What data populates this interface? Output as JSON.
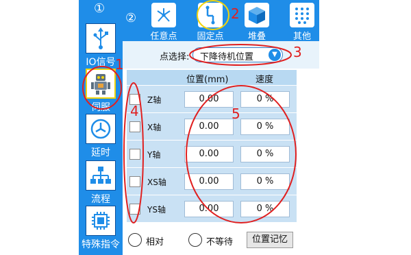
{
  "sidebar": {
    "top_badge": "①",
    "items": [
      {
        "label": "IO信号",
        "icon": "usb-icon"
      },
      {
        "label": "伺服",
        "icon": "robot-icon"
      },
      {
        "label": "延时",
        "icon": "clock-icon"
      },
      {
        "label": "流程",
        "icon": "flowchart-icon"
      },
      {
        "label": "特殊指令",
        "icon": "chip-icon"
      }
    ]
  },
  "tabs": {
    "badge": "②",
    "items": [
      {
        "label": "任意点",
        "icon": "scatter-points-icon"
      },
      {
        "label": "固定点",
        "icon": "fixed-point-icon"
      },
      {
        "label": "堆叠",
        "icon": "stack-box-icon"
      },
      {
        "label": "其他",
        "icon": "dot-grid-icon"
      }
    ]
  },
  "point_select": {
    "label": "点选择:",
    "value": "下降待机位置"
  },
  "table": {
    "headers": {
      "position": "位置(mm)",
      "speed": "速度"
    },
    "rows": [
      {
        "axis": "Z轴",
        "position": "0.00",
        "speed": "0 %"
      },
      {
        "axis": "X轴",
        "position": "0.00",
        "speed": "0 %"
      },
      {
        "axis": "Y轴",
        "position": "0.00",
        "speed": "0 %"
      },
      {
        "axis": "XS轴",
        "position": "0.00",
        "speed": "0 %"
      },
      {
        "axis": "YS轴",
        "position": "0.00",
        "speed": "0 %"
      }
    ]
  },
  "bottom": {
    "relative_label": "相对",
    "no_wait_label": "不等待",
    "memory_button": "位置记忆"
  },
  "annotations": {
    "n1": "1",
    "n2": "2",
    "n3": "3",
    "n4": "4",
    "n5": "5"
  },
  "colors": {
    "primary": "#1f8de8",
    "annotation": "#e02020",
    "row_bg": "#c9e1f4"
  }
}
